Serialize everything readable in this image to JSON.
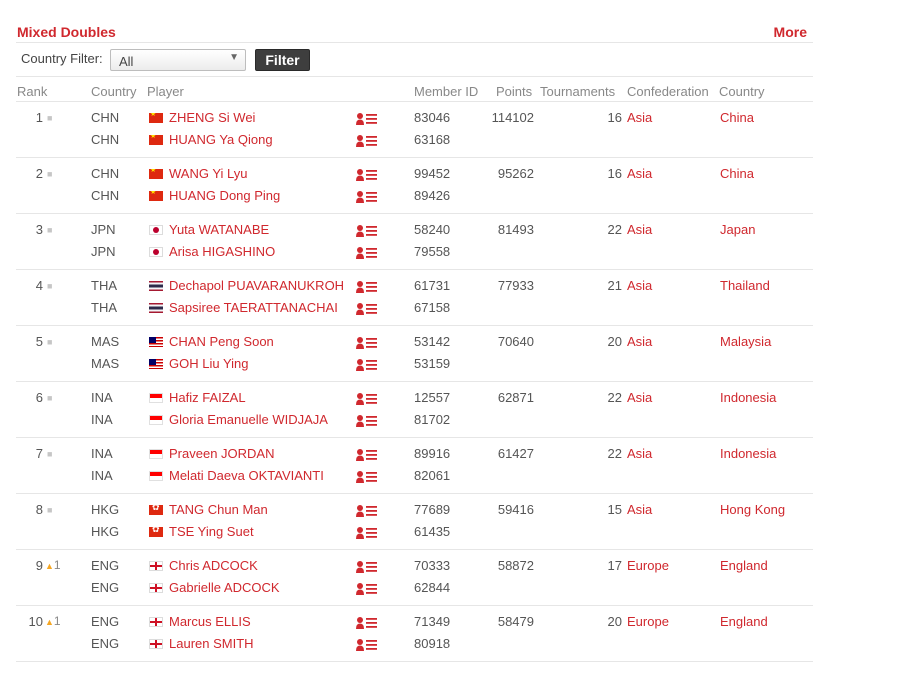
{
  "header": {
    "title": "Mixed Doubles",
    "more_label": "More"
  },
  "filter": {
    "label": "Country Filter:",
    "selected": "All",
    "button_label": "Filter"
  },
  "columns": {
    "rank": "Rank",
    "country": "Country",
    "player": "Player",
    "member_id": "Member ID",
    "points": "Points",
    "tournaments": "Tournaments",
    "confederation": "Confederation",
    "country_name": "Country"
  },
  "icons": {
    "flag_star": "★",
    "profile_icon": "profile-list-icon",
    "no_change": "■",
    "up_arrow": "▲"
  },
  "colors": {
    "accent": "#d0282e",
    "filter_button": "#3e3e3e",
    "rank_up": "#f5a623"
  },
  "rows": [
    {
      "rank": "1",
      "change": "",
      "direction": "same",
      "points": "114102",
      "tournaments": "16",
      "confederation": "Asia",
      "country": "China",
      "players": [
        {
          "code": "CHN",
          "flag": "chn",
          "name": "ZHENG Si Wei",
          "member_id": "83046"
        },
        {
          "code": "CHN",
          "flag": "chn",
          "name": "HUANG Ya Qiong",
          "member_id": "63168"
        }
      ]
    },
    {
      "rank": "2",
      "change": "",
      "direction": "same",
      "points": "95262",
      "tournaments": "16",
      "confederation": "Asia",
      "country": "China",
      "players": [
        {
          "code": "CHN",
          "flag": "chn",
          "name": "WANG Yi Lyu",
          "member_id": "99452"
        },
        {
          "code": "CHN",
          "flag": "chn",
          "name": "HUANG Dong Ping",
          "member_id": "89426"
        }
      ]
    },
    {
      "rank": "3",
      "change": "",
      "direction": "same",
      "points": "81493",
      "tournaments": "22",
      "confederation": "Asia",
      "country": "Japan",
      "players": [
        {
          "code": "JPN",
          "flag": "jpn",
          "name": "Yuta WATANABE",
          "member_id": "58240"
        },
        {
          "code": "JPN",
          "flag": "jpn",
          "name": "Arisa HIGASHINO",
          "member_id": "79558"
        }
      ]
    },
    {
      "rank": "4",
      "change": "",
      "direction": "same",
      "points": "77933",
      "tournaments": "21",
      "confederation": "Asia",
      "country": "Thailand",
      "players": [
        {
          "code": "THA",
          "flag": "tha",
          "name": "Dechapol PUAVARANUKROH",
          "member_id": "61731"
        },
        {
          "code": "THA",
          "flag": "tha",
          "name": "Sapsiree TAERATTANACHAI",
          "member_id": "67158"
        }
      ]
    },
    {
      "rank": "5",
      "change": "",
      "direction": "same",
      "points": "70640",
      "tournaments": "20",
      "confederation": "Asia",
      "country": "Malaysia",
      "players": [
        {
          "code": "MAS",
          "flag": "mas",
          "name": "CHAN Peng Soon",
          "member_id": "53142"
        },
        {
          "code": "MAS",
          "flag": "mas",
          "name": "GOH Liu Ying",
          "member_id": "53159"
        }
      ]
    },
    {
      "rank": "6",
      "change": "",
      "direction": "same",
      "points": "62871",
      "tournaments": "22",
      "confederation": "Asia",
      "country": "Indonesia",
      "players": [
        {
          "code": "INA",
          "flag": "ina",
          "name": "Hafiz FAIZAL",
          "member_id": "12557"
        },
        {
          "code": "INA",
          "flag": "ina",
          "name": "Gloria Emanuelle WIDJAJA",
          "member_id": "81702"
        }
      ]
    },
    {
      "rank": "7",
      "change": "",
      "direction": "same",
      "points": "61427",
      "tournaments": "22",
      "confederation": "Asia",
      "country": "Indonesia",
      "players": [
        {
          "code": "INA",
          "flag": "ina",
          "name": "Praveen JORDAN",
          "member_id": "89916"
        },
        {
          "code": "INA",
          "flag": "ina",
          "name": "Melati Daeva OKTAVIANTI",
          "member_id": "82061"
        }
      ]
    },
    {
      "rank": "8",
      "change": "",
      "direction": "same",
      "points": "59416",
      "tournaments": "15",
      "confederation": "Asia",
      "country": "Hong Kong",
      "players": [
        {
          "code": "HKG",
          "flag": "hkg",
          "name": "TANG Chun Man",
          "member_id": "77689"
        },
        {
          "code": "HKG",
          "flag": "hkg",
          "name": "TSE Ying Suet",
          "member_id": "61435"
        }
      ]
    },
    {
      "rank": "9",
      "change": "1",
      "direction": "up",
      "points": "58872",
      "tournaments": "17",
      "confederation": "Europe",
      "country": "England",
      "players": [
        {
          "code": "ENG",
          "flag": "eng",
          "name": "Chris ADCOCK",
          "member_id": "70333"
        },
        {
          "code": "ENG",
          "flag": "eng",
          "name": "Gabrielle ADCOCK",
          "member_id": "62844"
        }
      ]
    },
    {
      "rank": "10",
      "change": "1",
      "direction": "up",
      "points": "58479",
      "tournaments": "20",
      "confederation": "Europe",
      "country": "England",
      "players": [
        {
          "code": "ENG",
          "flag": "eng",
          "name": "Marcus ELLIS",
          "member_id": "71349"
        },
        {
          "code": "ENG",
          "flag": "eng",
          "name": "Lauren SMITH",
          "member_id": "80918"
        }
      ]
    }
  ]
}
